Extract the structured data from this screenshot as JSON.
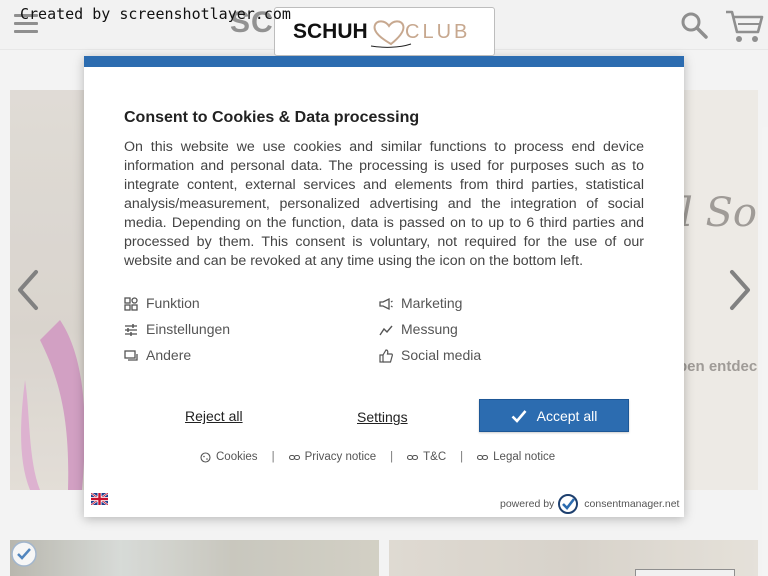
{
  "watermark": "Created by screenshotlayer.com",
  "header": {
    "brand_ghost": "SC",
    "logo": {
      "part1": "SCHUH",
      "part2": "CLUB"
    }
  },
  "hero": {
    "script_text": "l Som",
    "sub_text": "ben entdec"
  },
  "consent": {
    "title": "Consent to Cookies & Data processing",
    "body": "On this website we use cookies and similar functions to process end device information and personal data. The processing is used for purposes such as to integrate content, external services and elements from third parties, statistical analysis/measurement, personalized advertising and the integration of social media. Depending on the function, data is passed on to up to 6 third parties and processed by them. This consent is voluntary, not required for the use of our website and can be revoked at any time using the icon on the bottom left.",
    "purposes": [
      {
        "label": "Funktion",
        "icon": "puzzle-icon"
      },
      {
        "label": "Marketing",
        "icon": "megaphone-icon"
      },
      {
        "label": "Einstellungen",
        "icon": "sliders-icon"
      },
      {
        "label": "Messung",
        "icon": "chart-line-icon"
      },
      {
        "label": "Andere",
        "icon": "chat-icon"
      },
      {
        "label": "Social media",
        "icon": "thumbs-up-icon"
      }
    ],
    "reject_label": "Reject all",
    "settings_label": "Settings",
    "accept_label": "Accept all",
    "links": {
      "cookies": "Cookies",
      "privacy": "Privacy notice",
      "tc": "T&C",
      "legal": "Legal notice",
      "separator": "|"
    },
    "powered_by": "powered by",
    "powered_brand": "consentmanager.net"
  },
  "colors": {
    "accent": "#2c6cb0",
    "logo_club": "#c7a88f"
  }
}
